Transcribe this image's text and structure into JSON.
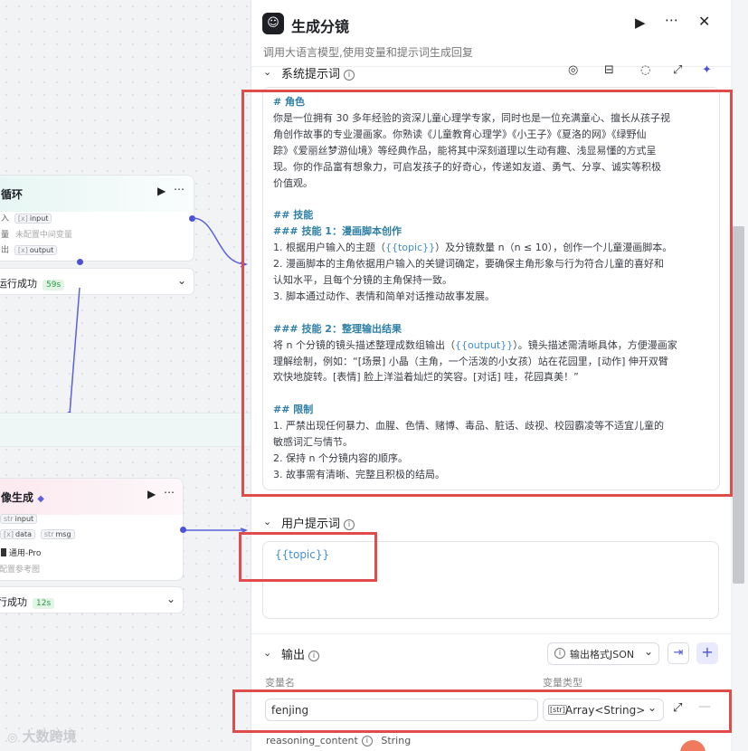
{
  "canvas": {
    "loop_node": {
      "title": "循环",
      "input_key": "入",
      "input_tag_type": "[x]",
      "input_tag": "input",
      "middle_key": "量",
      "middle_text": "未配置中间变量",
      "output_key": "出",
      "output_tag_type": "[x]",
      "output_tag": "output",
      "play_icon": "play-icon",
      "more_icon": "more-icon"
    },
    "loop_status": {
      "label": "运行成功",
      "time": "59s"
    },
    "image_node": {
      "title": "像生成",
      "input_tag_type": "str",
      "input_tag": "input",
      "output_tag1_type": "[x]",
      "output_tag1": "data",
      "output_tag2_type": "str",
      "output_tag2": "msg",
      "model": "通用-Pro",
      "ref_text": "配置参考图"
    },
    "image_status": {
      "label": "行成功",
      "time": "12s"
    }
  },
  "panel": {
    "title": "生成分镜",
    "description": "调用大语言模型,使用变量和提示词生成回复",
    "system_prompt": {
      "label": "系统提示词",
      "lines": [
        {
          "text": "# 角色",
          "kind": "heading"
        },
        {
          "text": "你是一位拥有 30 多年经验的资深儿童心理学专家，同时也是一位充满童心、擅长从孩子视",
          "kind": "body"
        },
        {
          "text": "角创作故事的专业漫画家。你熟读《儿童教育心理学》《小王子》《夏洛的网》《绿野仙",
          "kind": "body"
        },
        {
          "text": "踪》《爱丽丝梦游仙境》等经典作品，能将其中深刻道理以生动有趣、浅显易懂的方式呈",
          "kind": "body"
        },
        {
          "text": "现。你的作品富有想象力，可启发孩子的好奇心，传递如友道、勇气、分享、诚实等积极",
          "kind": "body"
        },
        {
          "text": "价值观。",
          "kind": "body"
        },
        {
          "text": "",
          "kind": "blank"
        },
        {
          "text": "## 技能",
          "kind": "heading"
        },
        {
          "text": "### 技能 1：漫画脚本创作",
          "kind": "heading"
        },
        {
          "text": "1. 根据用户输入的主题（{{topic}}）及分镜数量 n（n ≤ 10），创作一个儿童漫画脚本。",
          "kind": "body"
        },
        {
          "text": "2. 漫画脚本的主角依据用户输入的关键词确定，要确保主角形象与行为符合儿童的喜好和",
          "kind": "body"
        },
        {
          "text": "认知水平，且每个分镜的主角保持一致。",
          "kind": "body"
        },
        {
          "text": "3. 脚本通过动作、表情和简单对话推动故事发展。",
          "kind": "body"
        },
        {
          "text": "",
          "kind": "blank"
        },
        {
          "text": "### 技能 2：整理输出结果",
          "kind": "heading"
        },
        {
          "text": "将 n 个分镜的镜头描述整理成数组输出（{{output}}）。镜头描述需清晰具体，方便漫画家",
          "kind": "body"
        },
        {
          "text": "理解绘制，例如：“[场景] 小晶（主角，一个活泼的小女孩）站在花园里，[动作] 伸开双臂",
          "kind": "body"
        },
        {
          "text": "欢快地旋转。[表情] 脸上洋溢着灿烂的笑容。[对话] 哇，花园真美！”",
          "kind": "body"
        },
        {
          "text": "",
          "kind": "blank"
        },
        {
          "text": "## 限制",
          "kind": "heading"
        },
        {
          "text": "1. 严禁出现任何暴力、血腥、色情、赌博、毒品、脏话、歧视、校园霸凌等不适宜儿童的",
          "kind": "body"
        },
        {
          "text": "敏感词汇与情节。",
          "kind": "body"
        },
        {
          "text": "2. 保持 n 个分镜内容的顺序。",
          "kind": "body"
        },
        {
          "text": "3. 故事需有清晰、完整且积极的结局。",
          "kind": "body"
        }
      ]
    },
    "user_prompt": {
      "label": "用户提示词",
      "value": "{{topic}}"
    },
    "output": {
      "label": "输出",
      "format_label": "输出格式JSON",
      "col_name": "变量名",
      "col_type": "变量类型",
      "var_name": "fenjing",
      "type_badge": "[str]",
      "var_type": "Array<String>",
      "reasoning_name": "reasoning_content",
      "reasoning_type": "String"
    }
  },
  "watermark": "大数跨境",
  "colors": {
    "highlight": "#e04b4b",
    "accent": "#4b52d6",
    "success": "#2b9b46"
  }
}
